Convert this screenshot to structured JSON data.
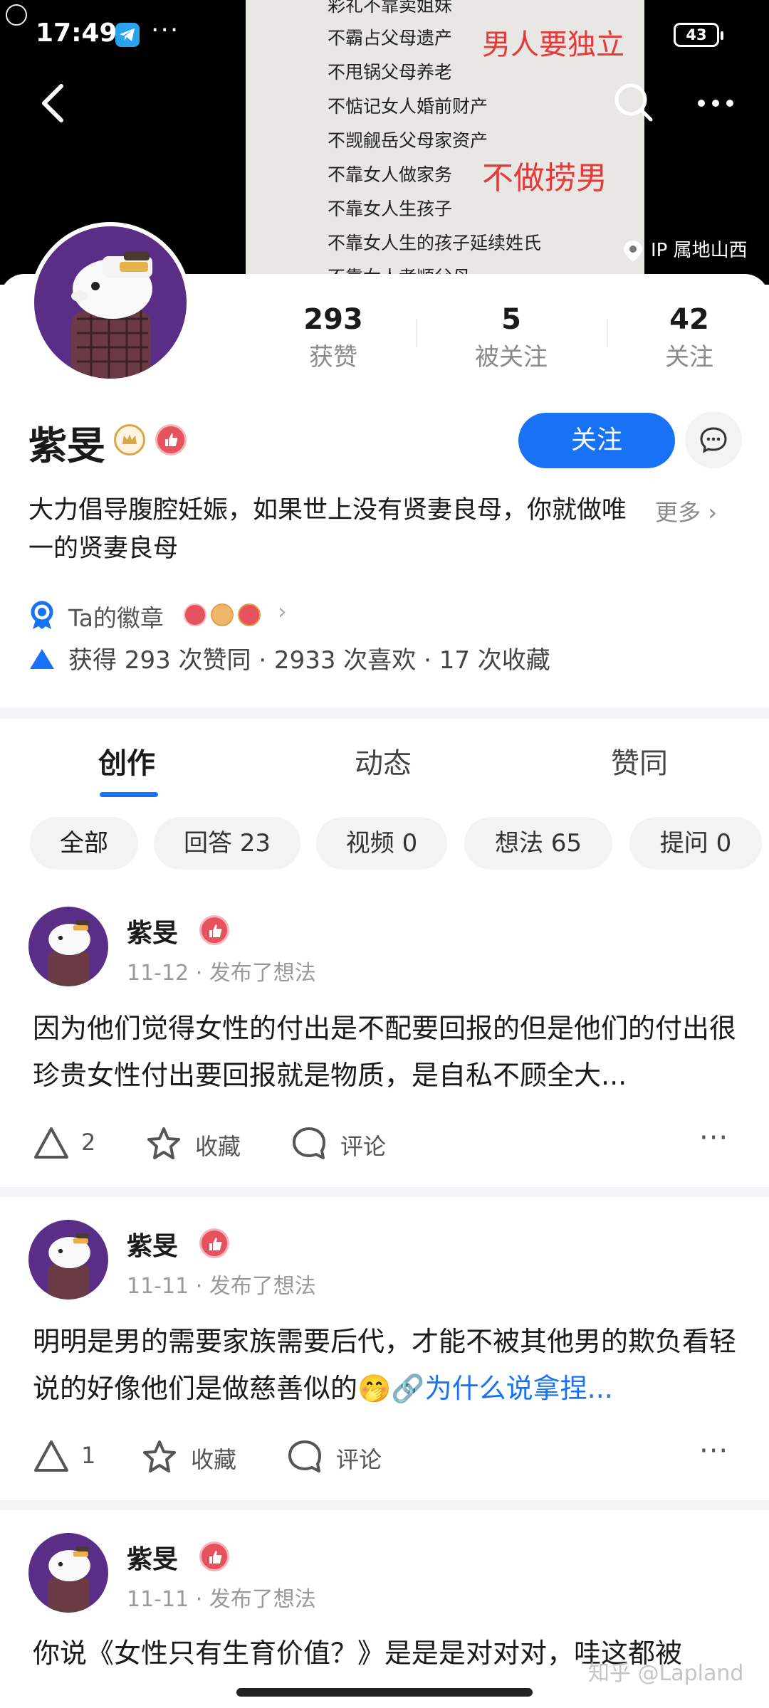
{
  "status_bar": {
    "time": "17:49",
    "battery": "43"
  },
  "cover": {
    "lines": [
      "彩礼不靠卖姐妹",
      "不霸占父母遗产",
      "不甩锅父母养老",
      "不惦记女人婚前财产",
      "不觊觎岳父母家资产",
      "不靠女人做家务",
      "不靠女人生孩子",
      "不靠女人生的孩子延续姓氏",
      "不靠女人孝顺父母"
    ],
    "red_text_1": "男人要独立",
    "red_text_2": "不做捞男",
    "ip_location": "IP 属地山西"
  },
  "profile": {
    "name": "紫旻",
    "stats": [
      {
        "value": "293",
        "label": "获赞"
      },
      {
        "value": "5",
        "label": "被关注"
      },
      {
        "value": "42",
        "label": "关注"
      }
    ],
    "follow_label": "关注",
    "bio": "大力倡导腹腔妊娠，如果世上没有贤妻良母，你就做唯一的贤妻良母",
    "more_label": "更多",
    "medals_label": "Ta的徽章",
    "summary": "获得 293 次赞同 · 2933 次喜欢 · 17 次收藏"
  },
  "tabs": [
    "创作",
    "动态",
    "赞同"
  ],
  "filters": [
    "全部",
    "回答 23",
    "视频 0",
    "想法 65",
    "提问 0"
  ],
  "posts": [
    {
      "author": "紫旻",
      "meta": "11-12 · 发布了想法",
      "text": "因为他们觉得女性的付出是不配要回报的但是他们的付出很珍贵女性付出要回报就是物质，是自私不顾全大...",
      "likes": "2",
      "collect_label": "收藏",
      "comment_label": "评论"
    },
    {
      "author": "紫旻",
      "meta": "11-11 · 发布了想法",
      "text": "明明是男的需要家族需要后代，才能不被其他男的欺负看轻说的好像他们是做慈善似的🤭",
      "link": "🔗为什么说拿捏...",
      "likes": "1",
      "collect_label": "收藏",
      "comment_label": "评论"
    },
    {
      "author": "紫旻",
      "meta": "11-11 · 发布了想法",
      "text": "你说《女性只有生育价值？》是是是对对对，哇这都被"
    }
  ],
  "watermark": "知乎 @Lapland",
  "colors": {
    "accent": "#1772f6",
    "avatar_bg": "#5a2e86",
    "badge_red": "#e6535f",
    "cover_red": "#e63a3a"
  }
}
